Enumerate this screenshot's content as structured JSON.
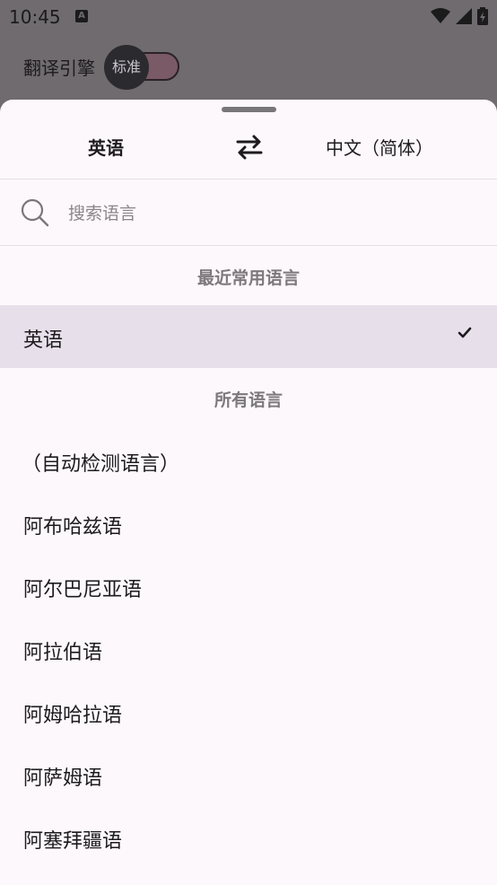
{
  "status_bar": {
    "time": "10:45",
    "notification_glyph": "A"
  },
  "background_app": {
    "title": "翻译引擎",
    "toggle_label": "标准"
  },
  "header": {
    "source_language": "英语",
    "target_language": "中文（简体）",
    "swap_icon": "swap-arrows-icon"
  },
  "search": {
    "placeholder": "搜索语言",
    "value": ""
  },
  "recent": {
    "title": "最近常用语言",
    "items": [
      {
        "label": "英语",
        "selected": true
      }
    ]
  },
  "all": {
    "title": "所有语言",
    "items": [
      {
        "label": "（自动检测语言）"
      },
      {
        "label": "阿布哈兹语"
      },
      {
        "label": "阿尔巴尼亚语"
      },
      {
        "label": "阿拉伯语"
      },
      {
        "label": "阿姆哈拉语"
      },
      {
        "label": "阿萨姆语"
      },
      {
        "label": "阿塞拜疆语"
      }
    ]
  },
  "colors": {
    "scrim": "#6f6b6f",
    "sheet": "#fdf8fb",
    "selected_row": "#e7e0ea",
    "section_text": "#7c787d"
  }
}
